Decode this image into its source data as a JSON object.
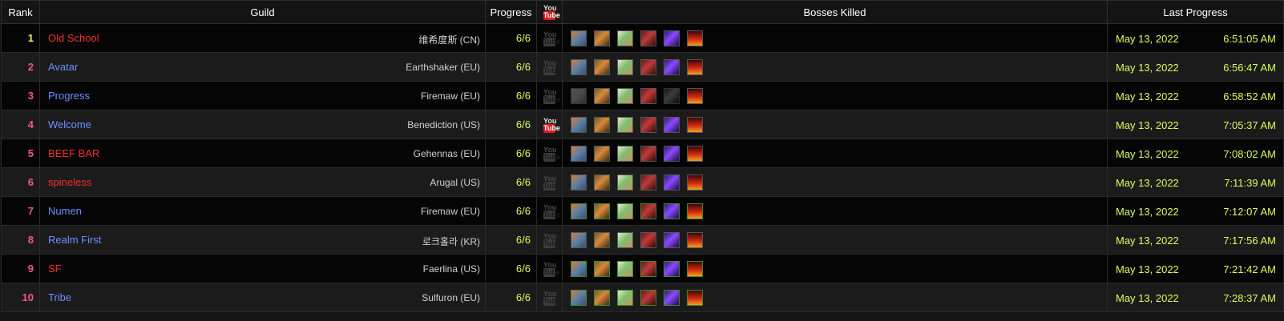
{
  "header": {
    "rank": "Rank",
    "guild": "Guild",
    "progress": "Progress",
    "video_icon": "youtube-icon",
    "bosses": "Bosses Killed",
    "last_progress": "Last Progress"
  },
  "colors": {
    "rank_top": "#f0ea65",
    "rank_other": "#f0569a",
    "guild_horde": "#f0312b",
    "guild_alliance": "#6e8fff",
    "progress_text": "#d7ff5a"
  },
  "rows": [
    {
      "rank": "1",
      "guild": "Old School",
      "realm": "维希度斯 (CN)",
      "progress": "6/6",
      "date": "May 13, 2022",
      "time": "6:51:05 AM"
    },
    {
      "rank": "2",
      "guild": "Avatar",
      "realm": "Earthshaker (EU)",
      "progress": "6/6",
      "date": "May 13, 2022",
      "time": "6:56:47 AM"
    },
    {
      "rank": "3",
      "guild": "Progress",
      "realm": "Firemaw (EU)",
      "progress": "6/6",
      "date": "May 13, 2022",
      "time": "6:58:52 AM"
    },
    {
      "rank": "4",
      "guild": "Welcome",
      "realm": "Benediction (US)",
      "progress": "6/6",
      "date": "May 13, 2022",
      "time": "7:05:37 AM"
    },
    {
      "rank": "5",
      "guild": "BEEF BAR",
      "realm": "Gehennas (EU)",
      "progress": "6/6",
      "date": "May 13, 2022",
      "time": "7:08:02 AM"
    },
    {
      "rank": "6",
      "guild": "spineless",
      "realm": "Arugal (US)",
      "progress": "6/6",
      "date": "May 13, 2022",
      "time": "7:11:39 AM"
    },
    {
      "rank": "7",
      "guild": "Numen",
      "realm": "Firemaw (EU)",
      "progress": "6/6",
      "date": "May 13, 2022",
      "time": "7:12:07 AM"
    },
    {
      "rank": "8",
      "guild": "Realm First",
      "realm": "로크홀라 (KR)",
      "progress": "6/6",
      "date": "May 13, 2022",
      "time": "7:17:56 AM"
    },
    {
      "rank": "9",
      "guild": "SF",
      "realm": "Faerlina (US)",
      "progress": "6/6",
      "date": "May 13, 2022",
      "time": "7:21:42 AM"
    },
    {
      "rank": "10",
      "guild": "Tribe",
      "realm": "Sulfuron (EU)",
      "progress": "6/6",
      "date": "May 13, 2022",
      "time": "7:28:37 AM"
    }
  ],
  "youtube_icon_text": {
    "you": "You",
    "tube": "Tube"
  }
}
